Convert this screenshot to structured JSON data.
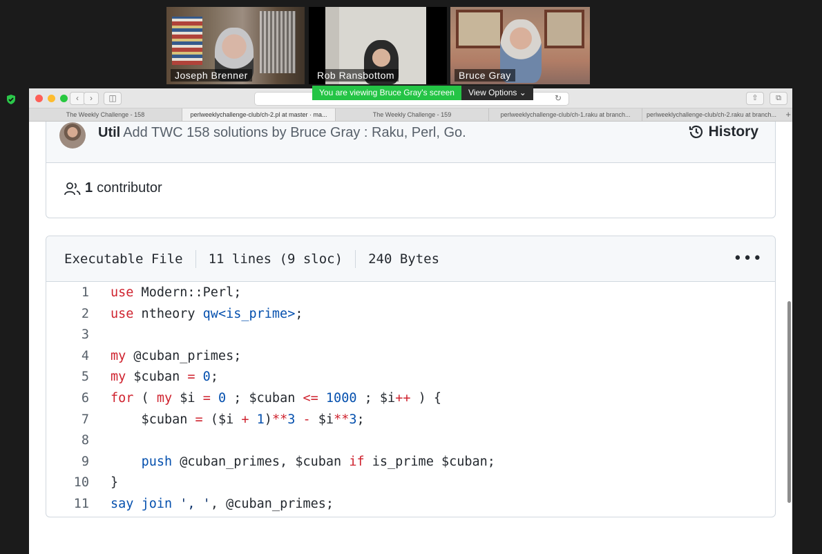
{
  "participants": [
    {
      "name": "Joseph Brenner"
    },
    {
      "name": "Rob Ransbottom"
    },
    {
      "name": "Bruce Gray"
    }
  ],
  "share_banner": {
    "message": "You are viewing Bruce Gray's screen",
    "options_label": "View Options"
  },
  "browser": {
    "tabs": [
      {
        "title": "The Weekly Challenge - 158"
      },
      {
        "title": "perlweeklychallenge-club/ch-2.pl at master · ma..."
      },
      {
        "title": "The Weekly Challenge - 159"
      },
      {
        "title": "perlweeklychallenge-club/ch-1.raku at branch..."
      },
      {
        "title": "perlweeklychallenge-club/ch-2.raku at branch..."
      }
    ],
    "active_tab": 1
  },
  "commit": {
    "author": "Util",
    "message": "Add TWC 158 solutions by Bruce Gray : Raku, Perl, Go.",
    "history_label": "History"
  },
  "contributors": {
    "count": "1",
    "label": "contributor"
  },
  "file": {
    "type": "Executable File",
    "lines": "11 lines (9 sloc)",
    "size": "240 Bytes"
  },
  "code": [
    {
      "n": "1",
      "tokens": [
        [
          "k",
          "use"
        ],
        [
          "t",
          " Modern::Perl;"
        ]
      ]
    },
    {
      "n": "2",
      "tokens": [
        [
          "k",
          "use"
        ],
        [
          "t",
          " ntheory "
        ],
        [
          "b",
          "qw<is_prime>"
        ],
        [
          "t",
          ";"
        ]
      ]
    },
    {
      "n": "3",
      "tokens": []
    },
    {
      "n": "4",
      "tokens": [
        [
          "k",
          "my"
        ],
        [
          "t",
          " @cuban_primes;"
        ]
      ]
    },
    {
      "n": "5",
      "tokens": [
        [
          "k",
          "my"
        ],
        [
          "t",
          " $cuban "
        ],
        [
          "k",
          "="
        ],
        [
          "t",
          " "
        ],
        [
          "b",
          "0"
        ],
        [
          "t",
          ";"
        ]
      ]
    },
    {
      "n": "6",
      "tokens": [
        [
          "k",
          "for"
        ],
        [
          "t",
          " ( "
        ],
        [
          "k",
          "my"
        ],
        [
          "t",
          " $i "
        ],
        [
          "k",
          "="
        ],
        [
          "t",
          " "
        ],
        [
          "b",
          "0"
        ],
        [
          "t",
          " ; $cuban "
        ],
        [
          "k",
          "<="
        ],
        [
          "t",
          " "
        ],
        [
          "b",
          "1000"
        ],
        [
          "t",
          " ; $i"
        ],
        [
          "k",
          "++"
        ],
        [
          "t",
          " ) {"
        ]
      ]
    },
    {
      "n": "7",
      "tokens": [
        [
          "t",
          "    $cuban "
        ],
        [
          "k",
          "="
        ],
        [
          "t",
          " ($i "
        ],
        [
          "k",
          "+"
        ],
        [
          "t",
          " "
        ],
        [
          "b",
          "1"
        ],
        [
          "t",
          ")"
        ],
        [
          "k",
          "**"
        ],
        [
          "b",
          "3"
        ],
        [
          "t",
          " "
        ],
        [
          "k",
          "-"
        ],
        [
          "t",
          " $i"
        ],
        [
          "k",
          "**"
        ],
        [
          "b",
          "3"
        ],
        [
          "t",
          ";"
        ]
      ]
    },
    {
      "n": "8",
      "tokens": []
    },
    {
      "n": "9",
      "tokens": [
        [
          "t",
          "    "
        ],
        [
          "b",
          "push"
        ],
        [
          "t",
          " @cuban_primes, $cuban "
        ],
        [
          "k",
          "if"
        ],
        [
          "t",
          " is_prime $cuban;"
        ]
      ]
    },
    {
      "n": "10",
      "tokens": [
        [
          "t",
          "}"
        ]
      ]
    },
    {
      "n": "11",
      "tokens": [
        [
          "b",
          "say"
        ],
        [
          "t",
          " "
        ],
        [
          "b",
          "join"
        ],
        [
          "t",
          " "
        ],
        [
          "s",
          "', '"
        ],
        [
          "t",
          ", @cuban_primes;"
        ]
      ]
    }
  ]
}
